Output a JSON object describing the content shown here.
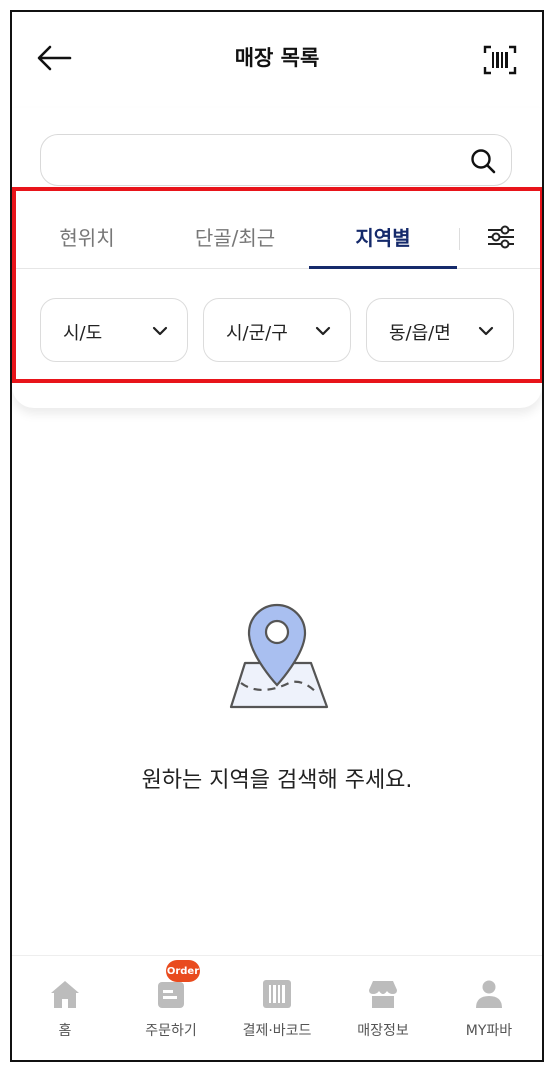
{
  "header": {
    "title": "매장 목록",
    "back_icon": "arrow-left-icon",
    "barcode_icon": "barcode-scan-icon"
  },
  "search": {
    "value": "",
    "placeholder": "",
    "icon": "search-icon"
  },
  "tabs": [
    {
      "label": "현위치",
      "active": false
    },
    {
      "label": "단골/최근",
      "active": false
    },
    {
      "label": "지역별",
      "active": true
    }
  ],
  "filter_icon": "sliders-icon",
  "dropdowns": [
    {
      "label": "시/도"
    },
    {
      "label": "시/군/구"
    },
    {
      "label": "동/읍/면"
    }
  ],
  "empty_state": {
    "icon": "map-pin-icon",
    "message": "원하는 지역을 검색해 주세요."
  },
  "bottom_nav": [
    {
      "label": "홈",
      "icon": "home-icon"
    },
    {
      "label": "주문하기",
      "icon": "order-icon",
      "badge": "Order"
    },
    {
      "label": "결제·바코드",
      "icon": "barcode-icon"
    },
    {
      "label": "매장정보",
      "icon": "store-icon"
    },
    {
      "label": "MY파바",
      "icon": "user-icon"
    }
  ],
  "colors": {
    "accent": "#152a6b",
    "highlight": "#e8141a",
    "badge": "#e94b1e",
    "map_pin": "#a9bff0"
  }
}
